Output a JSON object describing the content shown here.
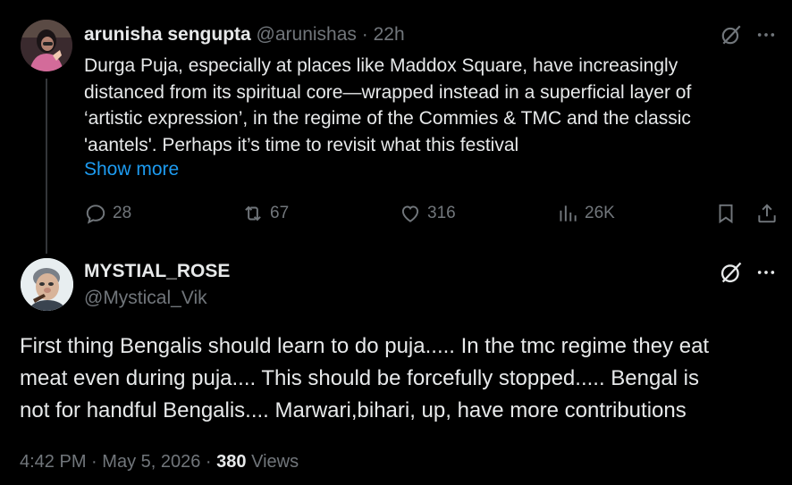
{
  "tweet1": {
    "display_name": "arunisha sengupta",
    "handle": "@arunishas",
    "separator": "·",
    "time": "22h",
    "lines": [
      "Durga Puja, especially at places like Maddox Square, have increasingly",
      "distanced from its spiritual core—wrapped instead in a superficial layer of",
      "‘artistic expression’, in the regime of the Commies & TMC and the classic",
      "'aantels'. Perhaps it’s time to revisit what this festival"
    ],
    "show_more": "Show more",
    "replies": "28",
    "reposts": "67",
    "likes": "316",
    "views": "26K"
  },
  "tweet2": {
    "display_name": "MYSTIAL_ROSE",
    "handle": "@Mystical_Vik",
    "lines": [
      "First thing Bengalis should learn to do puja..... In the tmc regime they eat",
      "meat even during puja.... This should be forcefully stopped..... Bengal is",
      "not for handful Bengalis.... Marwari,bihari, up, have more contributions"
    ],
    "time": "4:42 PM",
    "sep1": "·",
    "date": "May 5, 2026",
    "sep2": "·",
    "views_count": "380",
    "views_label": "Views"
  },
  "icons": {
    "grok": "grok-icon",
    "more": "more-icon",
    "reply": "reply-icon",
    "repost": "repost-icon",
    "like": "like-icon",
    "views": "views-icon",
    "bookmark": "bookmark-icon",
    "share": "share-icon"
  },
  "colors": {
    "background": "#000000",
    "text": "#e7e9ea",
    "muted": "#71767b",
    "link": "#1d9bf0",
    "thread_line": "#333639"
  }
}
